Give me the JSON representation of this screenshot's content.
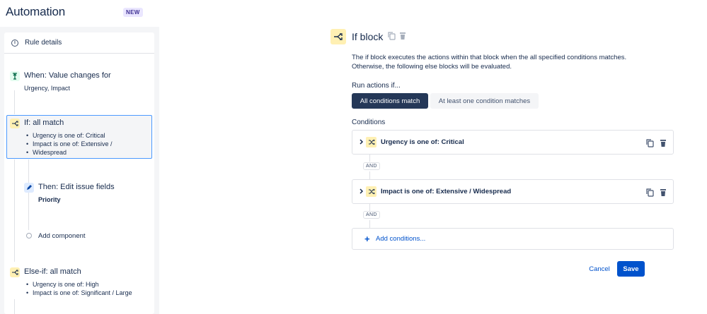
{
  "header": {
    "title": "Automation",
    "badge": "NEW"
  },
  "sidebar": {
    "rule_details": "Rule details",
    "trigger": {
      "title": "When: Value changes for",
      "sub": "Urgency, Impact"
    },
    "if_block": {
      "title": "If: all match",
      "items": [
        "Urgency is one of: Critical",
        "Impact is one of: Extensive /",
        "Widespread"
      ]
    },
    "action": {
      "title": "Then: Edit issue fields",
      "sub": "Priority"
    },
    "add_component": "Add component",
    "else_if": {
      "title": "Else-if: all match",
      "items": [
        "Urgency is one of: High",
        "Impact is one of: Significant / Large"
      ]
    }
  },
  "main": {
    "title": "If block",
    "description": "The if block executes the actions within that block when the all specified conditions matches. Otherwise, the following else blocks will be evaluated.",
    "run_label": "Run actions if...",
    "options": {
      "all": "All conditions match",
      "any": "At least one condition matches"
    },
    "conditions_label": "Conditions",
    "conditions": [
      "Urgency is one of: Critical",
      "Impact is one of: Extensive / Widespread"
    ],
    "and_label": "AND",
    "add_conditions": "Add conditions...",
    "cancel": "Cancel",
    "save": "Save"
  },
  "colors": {
    "primary": "#0052cc",
    "dark_button": "#253858",
    "condition_icon_bg": "#fff0b3",
    "selection_border": "#4c9aff"
  }
}
